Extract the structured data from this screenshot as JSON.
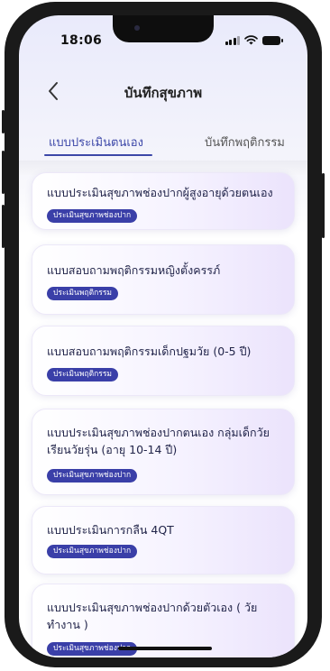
{
  "status_bar": {
    "time": "18:06"
  },
  "header": {
    "title": "บันทึกสุขภาพ"
  },
  "tabs": [
    {
      "label": "แบบประเมินตนเอง",
      "active": true
    },
    {
      "label": "บันทึกพฤติกรรม",
      "active": false
    }
  ],
  "cards": [
    {
      "title": "แบบประเมินสุขภาพช่องปากผู้สูงอายุด้วยตนเอง",
      "badge": "ประเมินสุขภาพช่องปาก"
    },
    {
      "title": "แบบสอบถามพฤติกรรมหญิงตั้งครรภ์",
      "badge": "ประเมินพฤติกรรม"
    },
    {
      "title": "แบบสอบถามพฤติกรรมเด็กปฐมวัย (0-5 ปี)",
      "badge": "ประเมินพฤติกรรม"
    },
    {
      "title": "แบบประเมินสุขภาพช่องปากตนเอง กลุ่มเด็กวัยเรียนวัยรุ่น (อายุ 10-14 ปี)",
      "badge": "ประเมินสุขภาพช่องปาก"
    },
    {
      "title": "แบบประเมินการกลืน 4QT",
      "badge": "ประเมินสุขภาพช่องปาก"
    },
    {
      "title": "แบบประเมินสุขภาพช่องปากด้วยตัวเอง ( วัยทำงาน )",
      "badge": "ประเมินสุขภาพช่องปาก"
    }
  ],
  "colors": {
    "accent": "#3c47a8",
    "badge_bg": "#3a3fa8",
    "frame": "#1a1a1a"
  }
}
